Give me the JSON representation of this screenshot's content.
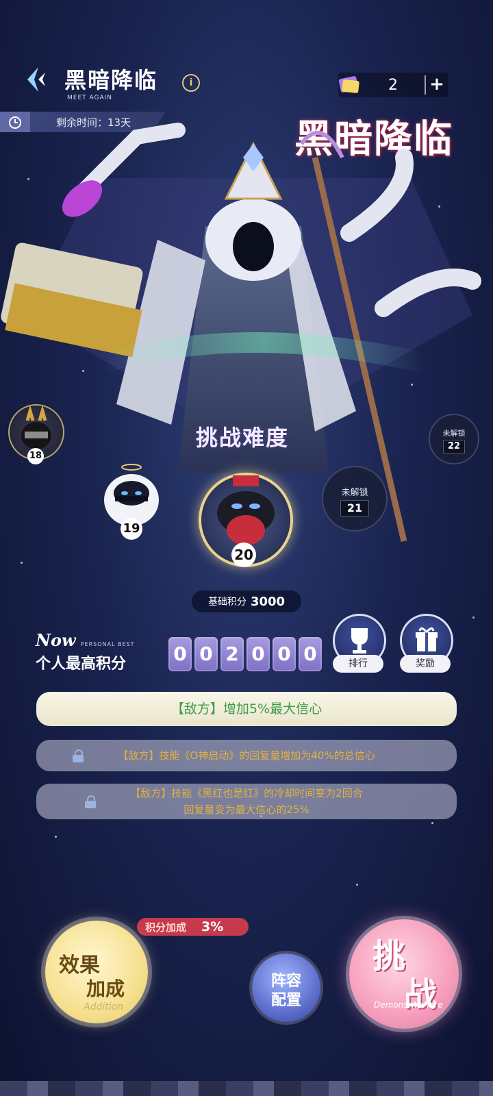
{
  "header": {
    "title": "黑暗降临",
    "subtitle": "MEET AGAIN",
    "currency_value": "2",
    "plus_label": "+"
  },
  "timer": {
    "text": "剩余时间：13天"
  },
  "event_logo": {
    "title": "黑暗降临",
    "subtitle": "Demons Warfare"
  },
  "difficulty": {
    "title": "挑战难度",
    "levels": [
      {
        "num": "18",
        "state": "unlocked"
      },
      {
        "num": "19",
        "state": "unlocked"
      },
      {
        "num": "20",
        "state": "selected"
      },
      {
        "num": "21",
        "state": "locked",
        "label": "未解锁"
      },
      {
        "num": "22",
        "state": "locked",
        "label": "未解锁"
      }
    ]
  },
  "base_score": {
    "label": "基础积分",
    "value": "3000"
  },
  "personal_best": {
    "now": "Now",
    "personal_best_en": "PERSONAL BEST",
    "label": "个人最高积分",
    "digits": [
      "0",
      "0",
      "2",
      "0",
      "0",
      "0"
    ]
  },
  "buttons": {
    "ranking_label": "排行",
    "reward_label": "奖励",
    "effect_line1": "效果",
    "effect_line2": "加成",
    "effect_en": "Addition",
    "formation_line1": "阵容",
    "formation_line2": "配置",
    "challenge_line1": "挑",
    "challenge_line2": "战",
    "challenge_en": "Demons Warfare"
  },
  "effects": [
    {
      "text": "【敌方】增加5%最大信心",
      "locked": false
    },
    {
      "text": "【敌方】技能《O神启动》的回复量增加为40%的总信心",
      "locked": true
    },
    {
      "text_line1": "【敌方】技能《黑红也是红》的冷却时间变为2回合",
      "text_line2": "回复量变为最大信心的25%",
      "locked": true
    }
  ],
  "bonus": {
    "label": "积分加成",
    "value": "3%"
  },
  "colors": {
    "accent_pink": "#c63a4b",
    "digit_purple": "#8f82d4",
    "effect_green": "#3a9c4a",
    "locked_gold": "#e2b23a"
  }
}
